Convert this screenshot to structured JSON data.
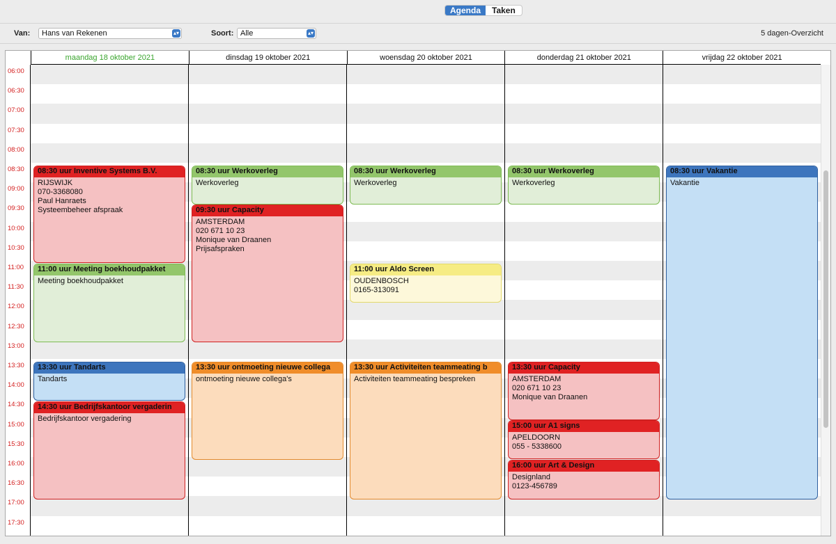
{
  "tabs": {
    "agenda": "Agenda",
    "taken": "Taken"
  },
  "toolbar": {
    "van_label": "Van:",
    "van_value": "Hans van Rekenen",
    "soort_label": "Soort:",
    "soort_value": "Alle",
    "overview": "5 dagen-Overzicht"
  },
  "days": [
    "maandag 18 oktober 2021",
    "dinsdag 19 oktober 2021",
    "woensdag 20 oktober 2021",
    "donderdag 21 oktober 2021",
    "vrijdag 22 oktober 2021"
  ],
  "times": [
    "06:00",
    "06:30",
    "07:00",
    "07:30",
    "08:00",
    "08:30",
    "09:00",
    "09:30",
    "10:00",
    "10:30",
    "11:00",
    "11:30",
    "12:00",
    "12:30",
    "13:00",
    "13:30",
    "14:00",
    "14:30",
    "15:00",
    "15:30",
    "16:00",
    "16:30",
    "17:00",
    "17:30"
  ],
  "events": {
    "mon_inventive": {
      "title": "08:30 uur Inventive Systems B.V.",
      "lines": [
        "RIJSWIJK",
        "070-3368080",
        "Paul Hanraets",
        "Systeembeheer afspraak"
      ]
    },
    "mon_meeting": {
      "title": "11:00 uur Meeting boekhoudpakket",
      "lines": [
        "Meeting boekhoudpakket"
      ]
    },
    "mon_tandarts": {
      "title": "13:30 uur Tandarts",
      "lines": [
        "Tandarts"
      ]
    },
    "mon_bedrijfskantoor": {
      "title": "14:30 uur Bedrijfskantoor vergaderin",
      "lines": [
        "Bedrijfskantoor vergadering"
      ]
    },
    "tue_werkoverleg": {
      "title": "08:30 uur Werkoverleg",
      "lines": [
        "Werkoverleg"
      ]
    },
    "tue_capacity": {
      "title": "09:30 uur Capacity",
      "lines": [
        "AMSTERDAM",
        "020 671 10 23",
        "Monique van Draanen",
        "Prijsafspraken"
      ]
    },
    "tue_ontmoeting": {
      "title": "13:30 uur ontmoeting nieuwe collega",
      "lines": [
        "ontmoeting nieuwe collega's"
      ]
    },
    "wed_werkoverleg": {
      "title": "08:30 uur Werkoverleg",
      "lines": [
        "Werkoverleg"
      ]
    },
    "wed_aldo": {
      "title": "11:00 uur Aldo Screen",
      "lines": [
        "OUDENBOSCH",
        "0165-313091"
      ]
    },
    "wed_activiteiten": {
      "title": "13:30 uur Activiteiten teammeating b",
      "lines": [
        "Activiteiten teammeating bespreken"
      ]
    },
    "thu_werkoverleg": {
      "title": "08:30 uur Werkoverleg",
      "lines": [
        "Werkoverleg"
      ]
    },
    "thu_capacity": {
      "title": "13:30 uur Capacity",
      "lines": [
        "AMSTERDAM",
        "020 671 10 23",
        "Monique van Draanen"
      ]
    },
    "thu_a1": {
      "title": "15:00 uur A1 signs",
      "lines": [
        "APELDOORN",
        "055 - 5338600"
      ]
    },
    "thu_art": {
      "title": "16:00 uur Art & Design",
      "lines": [
        "Designland",
        "0123-456789"
      ]
    },
    "fri_vakantie": {
      "title": "08:30 uur Vakantie",
      "lines": [
        "Vakantie"
      ]
    }
  },
  "colors": {
    "red": "#e02223",
    "green": "#93c66b",
    "blue": "#3d75bd",
    "orange": "#f08d2a",
    "yellow": "#f6ec84",
    "today": "#3aa52e",
    "time_label": "#d42020"
  }
}
